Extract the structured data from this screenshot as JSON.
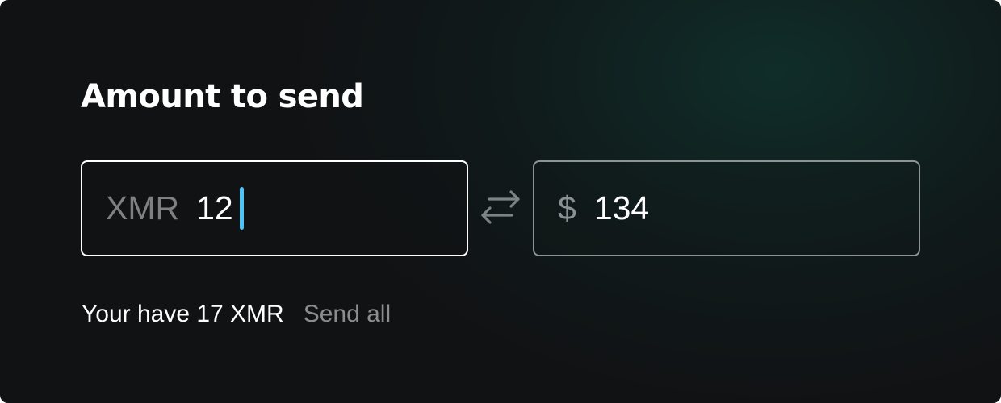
{
  "title": "Amount to send",
  "from_field": {
    "currency": "XMR",
    "value": "12"
  },
  "to_field": {
    "currency": "$",
    "value": "134"
  },
  "swap": {
    "icon": "swap-arrows-icon"
  },
  "balance": {
    "text": "Your have 17 XMR",
    "send_all_label": "Send all"
  },
  "colors": {
    "background": "#111214",
    "glow": "#103832",
    "caret": "#4ec4f5",
    "active_border": "#ffffff",
    "inactive_border": "#8d9594",
    "muted_text": "#808080"
  }
}
